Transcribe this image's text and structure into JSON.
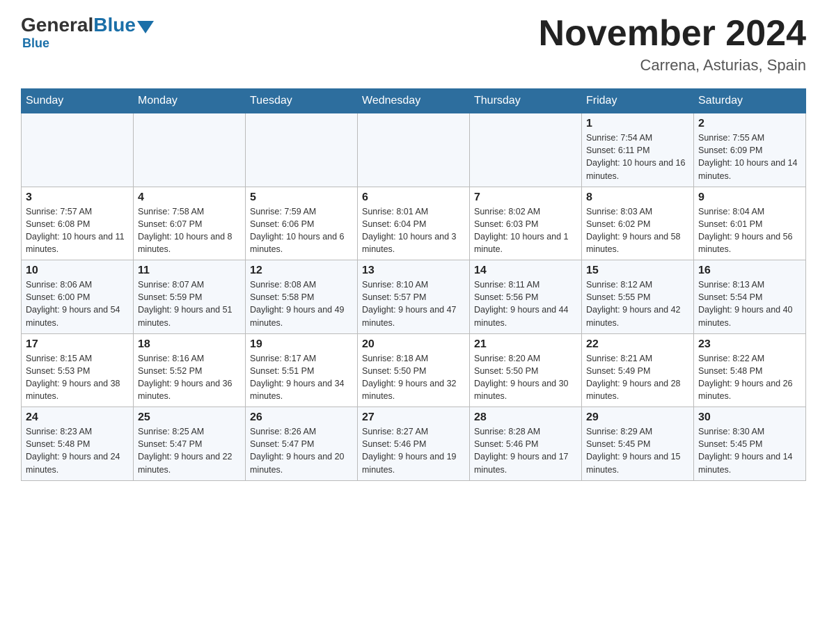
{
  "header": {
    "logo_general": "General",
    "logo_blue": "Blue",
    "main_title": "November 2024",
    "subtitle": "Carrena, Asturias, Spain"
  },
  "days_of_week": [
    "Sunday",
    "Monday",
    "Tuesday",
    "Wednesday",
    "Thursday",
    "Friday",
    "Saturday"
  ],
  "weeks": [
    [
      {
        "day": "",
        "info": ""
      },
      {
        "day": "",
        "info": ""
      },
      {
        "day": "",
        "info": ""
      },
      {
        "day": "",
        "info": ""
      },
      {
        "day": "",
        "info": ""
      },
      {
        "day": "1",
        "info": "Sunrise: 7:54 AM\nSunset: 6:11 PM\nDaylight: 10 hours and 16 minutes."
      },
      {
        "day": "2",
        "info": "Sunrise: 7:55 AM\nSunset: 6:09 PM\nDaylight: 10 hours and 14 minutes."
      }
    ],
    [
      {
        "day": "3",
        "info": "Sunrise: 7:57 AM\nSunset: 6:08 PM\nDaylight: 10 hours and 11 minutes."
      },
      {
        "day": "4",
        "info": "Sunrise: 7:58 AM\nSunset: 6:07 PM\nDaylight: 10 hours and 8 minutes."
      },
      {
        "day": "5",
        "info": "Sunrise: 7:59 AM\nSunset: 6:06 PM\nDaylight: 10 hours and 6 minutes."
      },
      {
        "day": "6",
        "info": "Sunrise: 8:01 AM\nSunset: 6:04 PM\nDaylight: 10 hours and 3 minutes."
      },
      {
        "day": "7",
        "info": "Sunrise: 8:02 AM\nSunset: 6:03 PM\nDaylight: 10 hours and 1 minute."
      },
      {
        "day": "8",
        "info": "Sunrise: 8:03 AM\nSunset: 6:02 PM\nDaylight: 9 hours and 58 minutes."
      },
      {
        "day": "9",
        "info": "Sunrise: 8:04 AM\nSunset: 6:01 PM\nDaylight: 9 hours and 56 minutes."
      }
    ],
    [
      {
        "day": "10",
        "info": "Sunrise: 8:06 AM\nSunset: 6:00 PM\nDaylight: 9 hours and 54 minutes."
      },
      {
        "day": "11",
        "info": "Sunrise: 8:07 AM\nSunset: 5:59 PM\nDaylight: 9 hours and 51 minutes."
      },
      {
        "day": "12",
        "info": "Sunrise: 8:08 AM\nSunset: 5:58 PM\nDaylight: 9 hours and 49 minutes."
      },
      {
        "day": "13",
        "info": "Sunrise: 8:10 AM\nSunset: 5:57 PM\nDaylight: 9 hours and 47 minutes."
      },
      {
        "day": "14",
        "info": "Sunrise: 8:11 AM\nSunset: 5:56 PM\nDaylight: 9 hours and 44 minutes."
      },
      {
        "day": "15",
        "info": "Sunrise: 8:12 AM\nSunset: 5:55 PM\nDaylight: 9 hours and 42 minutes."
      },
      {
        "day": "16",
        "info": "Sunrise: 8:13 AM\nSunset: 5:54 PM\nDaylight: 9 hours and 40 minutes."
      }
    ],
    [
      {
        "day": "17",
        "info": "Sunrise: 8:15 AM\nSunset: 5:53 PM\nDaylight: 9 hours and 38 minutes."
      },
      {
        "day": "18",
        "info": "Sunrise: 8:16 AM\nSunset: 5:52 PM\nDaylight: 9 hours and 36 minutes."
      },
      {
        "day": "19",
        "info": "Sunrise: 8:17 AM\nSunset: 5:51 PM\nDaylight: 9 hours and 34 minutes."
      },
      {
        "day": "20",
        "info": "Sunrise: 8:18 AM\nSunset: 5:50 PM\nDaylight: 9 hours and 32 minutes."
      },
      {
        "day": "21",
        "info": "Sunrise: 8:20 AM\nSunset: 5:50 PM\nDaylight: 9 hours and 30 minutes."
      },
      {
        "day": "22",
        "info": "Sunrise: 8:21 AM\nSunset: 5:49 PM\nDaylight: 9 hours and 28 minutes."
      },
      {
        "day": "23",
        "info": "Sunrise: 8:22 AM\nSunset: 5:48 PM\nDaylight: 9 hours and 26 minutes."
      }
    ],
    [
      {
        "day": "24",
        "info": "Sunrise: 8:23 AM\nSunset: 5:48 PM\nDaylight: 9 hours and 24 minutes."
      },
      {
        "day": "25",
        "info": "Sunrise: 8:25 AM\nSunset: 5:47 PM\nDaylight: 9 hours and 22 minutes."
      },
      {
        "day": "26",
        "info": "Sunrise: 8:26 AM\nSunset: 5:47 PM\nDaylight: 9 hours and 20 minutes."
      },
      {
        "day": "27",
        "info": "Sunrise: 8:27 AM\nSunset: 5:46 PM\nDaylight: 9 hours and 19 minutes."
      },
      {
        "day": "28",
        "info": "Sunrise: 8:28 AM\nSunset: 5:46 PM\nDaylight: 9 hours and 17 minutes."
      },
      {
        "day": "29",
        "info": "Sunrise: 8:29 AM\nSunset: 5:45 PM\nDaylight: 9 hours and 15 minutes."
      },
      {
        "day": "30",
        "info": "Sunrise: 8:30 AM\nSunset: 5:45 PM\nDaylight: 9 hours and 14 minutes."
      }
    ]
  ]
}
